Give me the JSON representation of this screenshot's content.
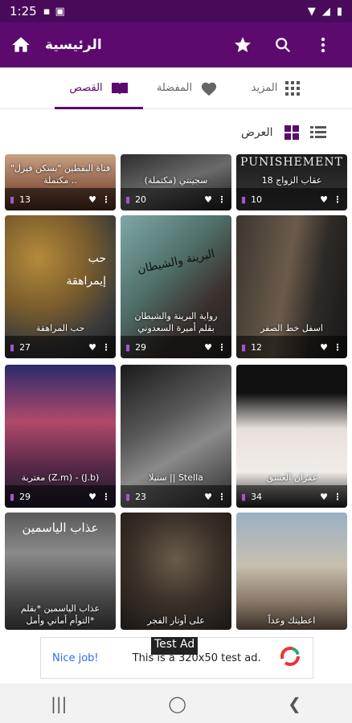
{
  "status": {
    "time": "1:25"
  },
  "app_bar": {
    "title": "الرئيسية"
  },
  "tabs": [
    {
      "label": "المزيد"
    },
    {
      "label": "المفضلة"
    },
    {
      "label": "القصص"
    }
  ],
  "view": {
    "label": "العرض"
  },
  "stories": [
    {
      "title": "فتاة البقطين \"بسكن فيرل\" .. مكتملة",
      "count": "13"
    },
    {
      "title": "سجينتي (مكتملة)",
      "count": "20"
    },
    {
      "title": "عقاب الزواج 18",
      "count": "10",
      "cover_text": "PUNISHEMENT"
    },
    {
      "title": "حب المراهقة",
      "count": "27",
      "cover_text": "حب\nإيمراهقة"
    },
    {
      "title": "رواية البرينة والشيطان بقلم أميرة السعدوني",
      "count": "29",
      "cover_text": "البرينة والشيطان"
    },
    {
      "title": "اسفل خط الصفر",
      "count": "12"
    },
    {
      "title": "مغتربة (Z.m) - (J.b)",
      "count": "29"
    },
    {
      "title": "ستيلا || Stella",
      "count": "23"
    },
    {
      "title": "غفران العشق",
      "count": "34"
    },
    {
      "title": "عذاب الياسمين *بقلم التوأم أماني وأمل*",
      "count": "",
      "cover_text": "عذاب الياسمين"
    },
    {
      "title": "على أوتار الفجر",
      "count": ""
    },
    {
      "title": "اعطيتك وعداً",
      "count": ""
    }
  ],
  "ad": {
    "label": "Test Ad",
    "nice": "Nice job!",
    "message": "This is a 320x50 test ad."
  },
  "colors": {
    "primary": "#5c0a6e",
    "status_bar": "#4a0a5a"
  }
}
